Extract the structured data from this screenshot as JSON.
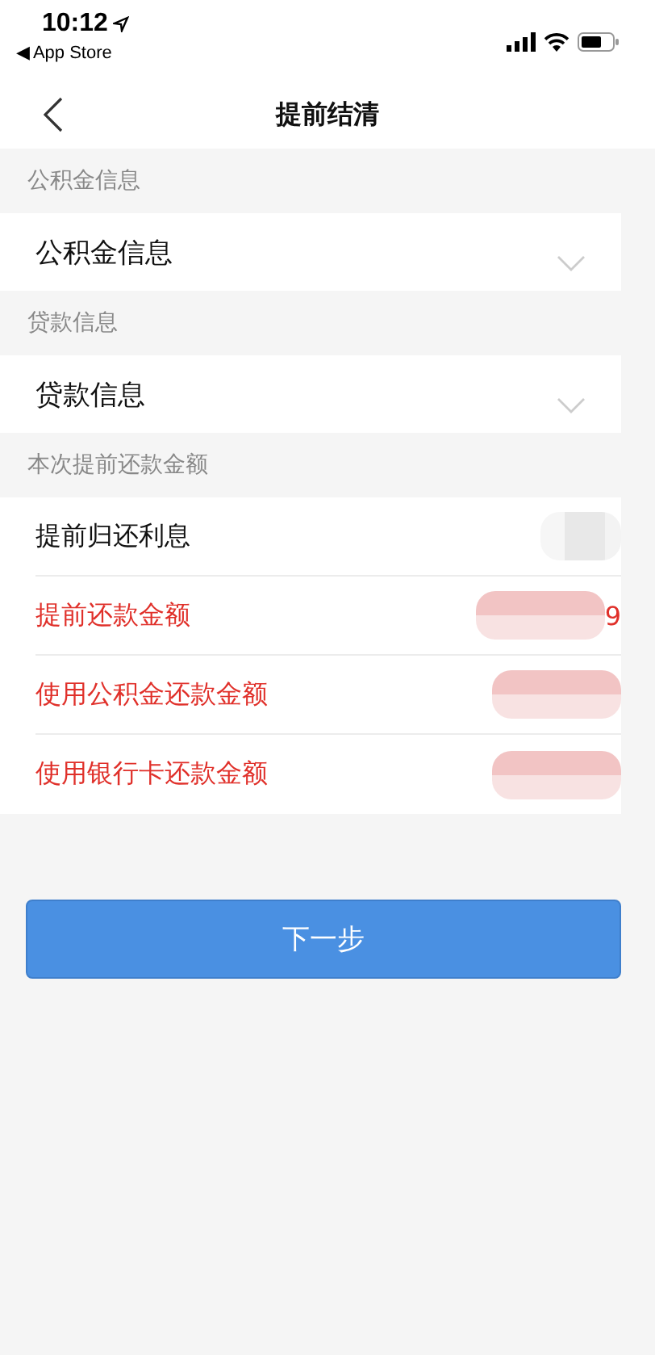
{
  "status_bar": {
    "time": "10:12",
    "back_app": "◀ App Store"
  },
  "nav": {
    "title": "提前结清"
  },
  "sections": [
    {
      "header": "公积金信息",
      "kind": "dropdown",
      "label": "公积金信息",
      "expanded": false
    },
    {
      "header": "贷款信息",
      "kind": "dropdown",
      "label": "贷款信息",
      "expanded": false
    }
  ],
  "amount_section": {
    "header": "本次提前还款金额",
    "rows": [
      {
        "label": "提前归还利息",
        "highlight": false
      },
      {
        "label": "提前还款金额",
        "highlight": true,
        "value_tail": "9"
      },
      {
        "label": "使用公积金还款金额",
        "highlight": true
      },
      {
        "label": "使用银行卡还款金额",
        "highlight": true
      }
    ]
  },
  "next_button": "下一步"
}
